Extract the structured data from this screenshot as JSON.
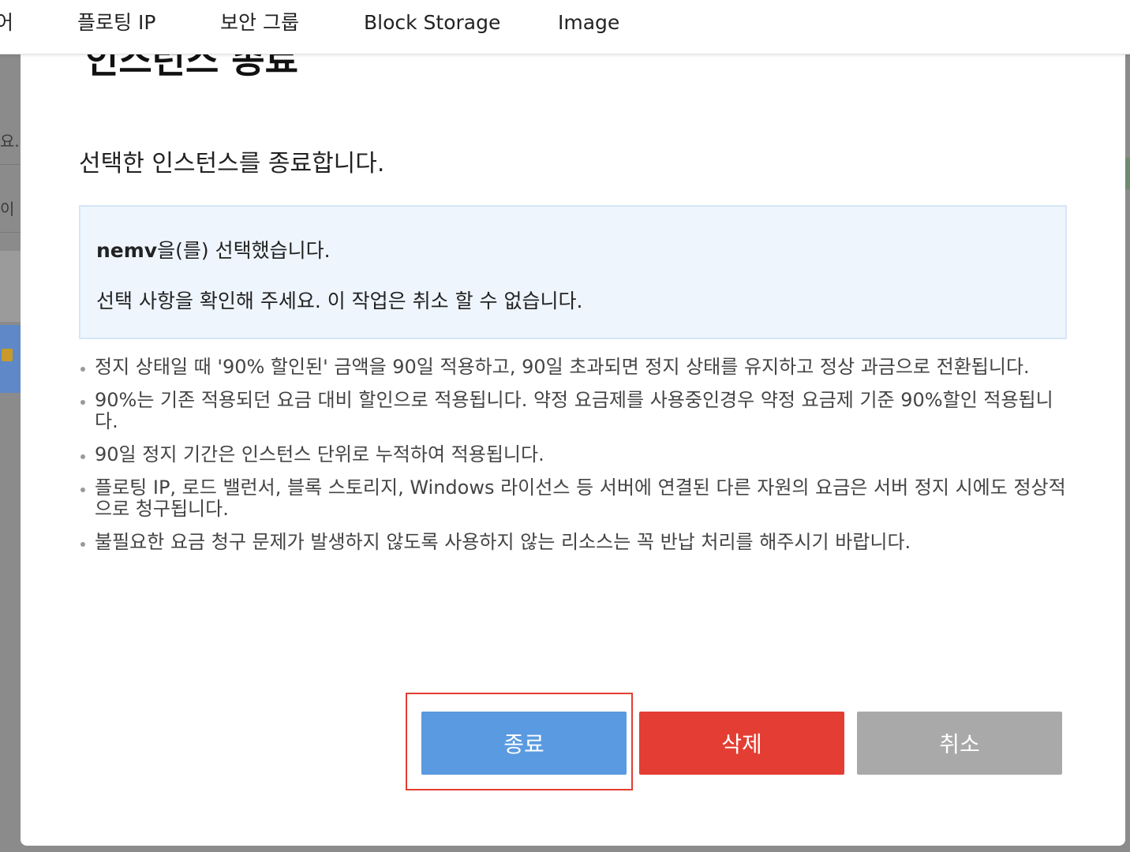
{
  "nav": {
    "partial_left": "어",
    "items": [
      "플로팅 IP",
      "보안 그룹",
      "Block Storage",
      "Image"
    ]
  },
  "background": {
    "input1_fragment": "요.",
    "input2_fragment": "이미"
  },
  "modal": {
    "title": "인스턴스 종료",
    "subtitle": "선택한 인스턴스를 종료합니다.",
    "info": {
      "selected_name": "nemv",
      "selected_suffix": "을(를) 선택했습니다.",
      "confirm_text": "선택 사항을 확인해 주세요. 이 작업은 취소 할 수 없습니다."
    },
    "notes": [
      "정지 상태일 때 '90% 할인된' 금액을 90일 적용하고, 90일 초과되면 정지 상태를 유지하고 정상 과금으로 전환됩니다.",
      "90%는 기존 적용되던 요금 대비 할인으로 적용됩니다. 약정 요금제를 사용중인경우 약정 요금제 기준 90%할인 적용됩니다.",
      "90일 정지 기간은 인스턴스 단위로 누적하여 적용됩니다.",
      "플로팅 IP, 로드 밸런서, 블록 스토리지, Windows 라이선스 등 서버에 연결된 다른 자원의 요금은 서버 정지 시에도 정상적으로 청구됩니다.",
      "불필요한 요금 청구 문제가 발생하지 않도록 사용하지 않는 리소스는 꼭 반납 처리를 해주시기 바랍니다."
    ],
    "buttons": {
      "stop": "종료",
      "delete": "삭제",
      "cancel": "취소"
    }
  },
  "colors": {
    "stop_button": "#5a9ae0",
    "delete_button": "#e43d33",
    "cancel_button": "#a9a9a9",
    "info_box_bg": "#eef5fd",
    "highlight_border": "#e43d33"
  }
}
